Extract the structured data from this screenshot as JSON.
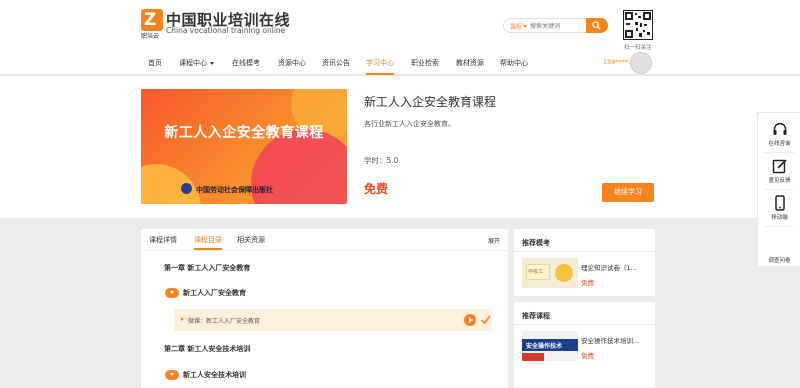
{
  "brand": {
    "badge_letter": "Z",
    "badge_caption": "职培云",
    "title": "中国职业培训在线",
    "subtitle": "China vocational training online"
  },
  "search": {
    "category": "课程",
    "placeholder": "搜索关键词"
  },
  "qr": {
    "caption": "扫一扫关注"
  },
  "nav": {
    "items": [
      {
        "label": "首页"
      },
      {
        "label": "课程中心"
      },
      {
        "label": "在线模考"
      },
      {
        "label": "资源中心"
      },
      {
        "label": "资讯公告"
      },
      {
        "label": "学习中心"
      },
      {
        "label": "职业检索"
      },
      {
        "label": "教材资源"
      },
      {
        "label": "帮助中心"
      }
    ],
    "active": "学习中心"
  },
  "user": {
    "phone": "159****..."
  },
  "course": {
    "cover_title": "新工人入企安全教育课程",
    "cover_publisher": "中国劳动社会保障出版社",
    "title": "新工人入企安全教育课程",
    "description": "各行业新工人入企安全教育。",
    "hours": "学时：5.0",
    "price": "免费",
    "action": "继续学习"
  },
  "float_bar": {
    "items": [
      {
        "label": "在线咨询",
        "icon": "headset-icon"
      },
      {
        "label": "意见反馈",
        "icon": "edit-icon"
      },
      {
        "label": "移动端",
        "icon": "mobile-icon"
      },
      {
        "label": "调查问卷",
        "icon": "survey-icon"
      }
    ]
  },
  "tabs": {
    "items": [
      {
        "label": "课程详情"
      },
      {
        "label": "课程目录"
      },
      {
        "label": "相关资源"
      }
    ],
    "active": "课程目录",
    "expand": "展开"
  },
  "catalog": {
    "chapter1": "第一章 新工人入厂安全教育",
    "section1": "新工人入厂安全教育",
    "lesson1": "微课：新工人入厂安全教育",
    "chapter2": "第二章 新工人安全技术培训",
    "section2": "新工人安全技术培训"
  },
  "recommend_exam": {
    "heading": "推荐模考",
    "item_title": "理论知识试卷（1...",
    "item_price": "免费",
    "thumb_text": "中级工"
  },
  "recommend_course": {
    "heading": "推荐课程",
    "item_title": "安全操作技术培训...",
    "item_price": "免费",
    "thumb_text": "安全操作技术"
  },
  "colors": {
    "accent": "#f5841f",
    "price": "#e94e2a",
    "active_bg": "#fdf1de"
  }
}
